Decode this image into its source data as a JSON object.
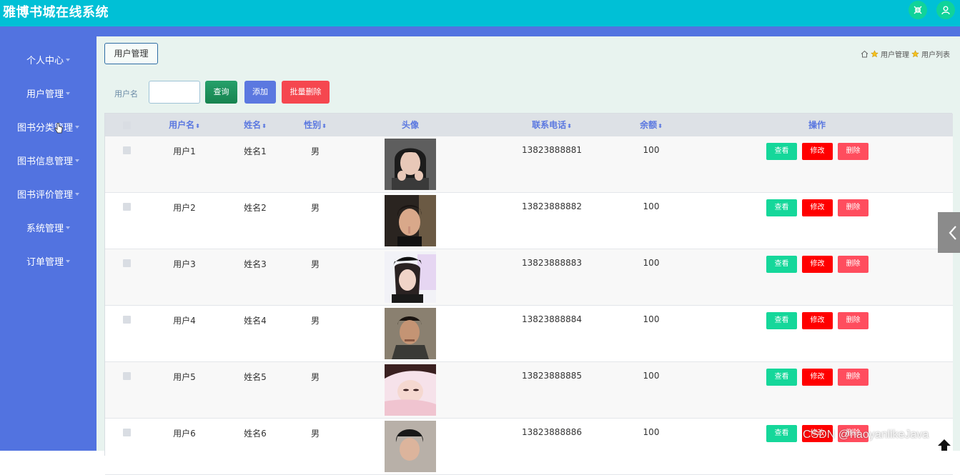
{
  "app": {
    "title": "雅博书城在线系统"
  },
  "header": {
    "icons": [
      "shrink-icon",
      "user-icon"
    ],
    "bg_color": "#00c0d6"
  },
  "sidebar": {
    "items": [
      {
        "label": "个人中心"
      },
      {
        "label": "用户管理"
      },
      {
        "label": "图书分类管理"
      },
      {
        "label": "图书信息管理"
      },
      {
        "label": "图书评价管理"
      },
      {
        "label": "系统管理"
      },
      {
        "label": "订单管理"
      }
    ]
  },
  "tab": {
    "label": "用户管理"
  },
  "breadcrumb": {
    "level1": "用户管理",
    "level2": "用户列表"
  },
  "search": {
    "label": "用户名",
    "value": "",
    "placeholder": ""
  },
  "toolbar": {
    "query_label": "查询",
    "add_label": "添加",
    "batch_delete_label": "批量删除"
  },
  "table": {
    "headers": {
      "username": "用户名",
      "name": "姓名",
      "gender": "性别",
      "avatar": "头像",
      "phone": "联系电话",
      "balance": "余额",
      "actions": "操作"
    },
    "sort_glyph": "⬍",
    "action_labels": {
      "view": "查看",
      "edit": "修改",
      "delete": "删除"
    },
    "rows": [
      {
        "username": "用户1",
        "name": "姓名1",
        "gender": "男",
        "phone": "13823888881",
        "balance": "100"
      },
      {
        "username": "用户2",
        "name": "姓名2",
        "gender": "男",
        "phone": "13823888882",
        "balance": "100"
      },
      {
        "username": "用户3",
        "name": "姓名3",
        "gender": "男",
        "phone": "13823888883",
        "balance": "100"
      },
      {
        "username": "用户4",
        "name": "姓名4",
        "gender": "男",
        "phone": "13823888884",
        "balance": "100"
      },
      {
        "username": "用户5",
        "name": "姓名5",
        "gender": "男",
        "phone": "13823888885",
        "balance": "100"
      },
      {
        "username": "用户6",
        "name": "姓名6",
        "gender": "男",
        "phone": "13823888886",
        "balance": "100"
      }
    ]
  },
  "watermark": {
    "text": "CSDN @haoyanlikeJava"
  },
  "colors": {
    "primary": "#5273e0",
    "view": "#15d79a",
    "edit": "#ff0000",
    "delete": "#ff4d5e",
    "query": "#17834f",
    "batch_delete": "#f5474f"
  }
}
